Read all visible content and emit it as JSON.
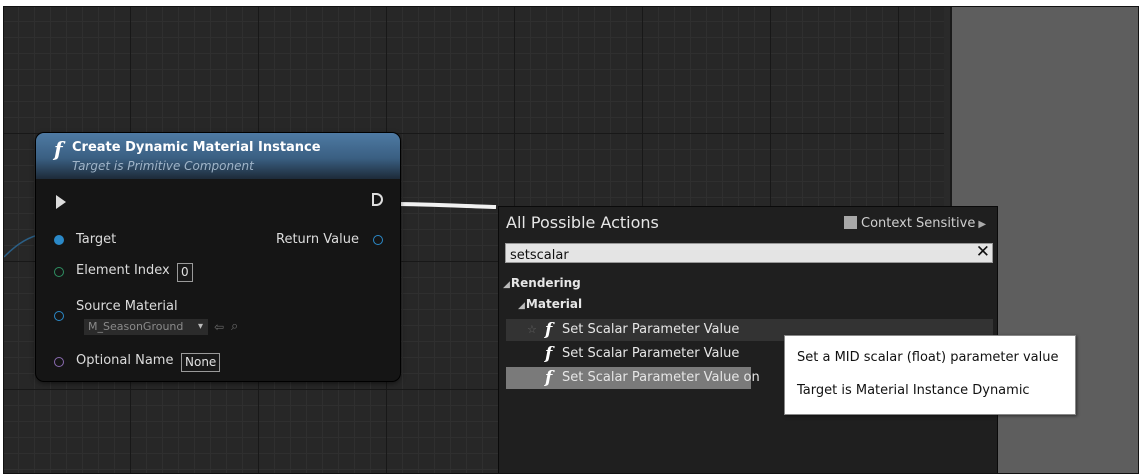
{
  "node": {
    "title": "Create Dynamic Material Instance",
    "subtitle": "Target is Primitive Component",
    "pins": {
      "target": "Target",
      "element_index": "Element Index",
      "element_index_value": "0",
      "source_material": "Source Material",
      "source_material_value": "M_SeasonGround",
      "optional_name": "Optional Name",
      "optional_name_value": "None",
      "return_value": "Return Value"
    }
  },
  "menu": {
    "title": "All Possible Actions",
    "context_sensitive": "Context Sensitive",
    "search": {
      "value": "setscalar"
    },
    "categories": {
      "rendering": "Rendering",
      "material": "Material"
    },
    "items": [
      "Set Scalar Parameter Value",
      "Set Scalar Parameter Value",
      "Set Scalar Parameter Value on"
    ]
  },
  "tooltip": {
    "line1": "Set a MID scalar (float) parameter value",
    "line2": "Target is Material Instance Dynamic"
  },
  "colors": {
    "node_header": "#4e7aa3",
    "object_pin": "#2b89c8",
    "int_pin": "#2f8f62",
    "name_pin": "#8a6bb0",
    "selected_item": "#7a7a7a"
  },
  "icons": {
    "function": "f",
    "exec_in": "triangle",
    "exec_out": "exec-arrow",
    "clear": "✕",
    "star": "☆",
    "dropdown": "▾",
    "use": "⇦",
    "browse": "⌕"
  }
}
